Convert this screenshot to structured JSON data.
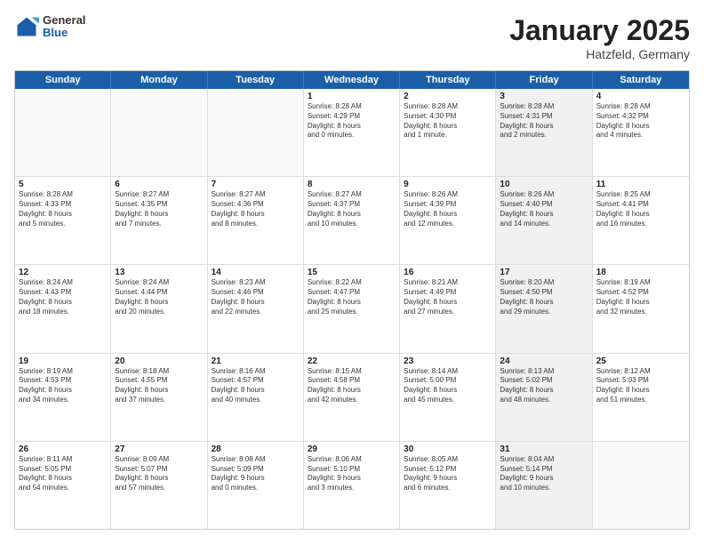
{
  "header": {
    "logo_general": "General",
    "logo_blue": "Blue",
    "title": "January 2025",
    "location": "Hatzfeld, Germany"
  },
  "days_of_week": [
    "Sunday",
    "Monday",
    "Tuesday",
    "Wednesday",
    "Thursday",
    "Friday",
    "Saturday"
  ],
  "rows": [
    [
      {
        "day": "",
        "lines": [],
        "empty": true
      },
      {
        "day": "",
        "lines": [],
        "empty": true
      },
      {
        "day": "",
        "lines": [],
        "empty": true
      },
      {
        "day": "1",
        "lines": [
          "Sunrise: 8:28 AM",
          "Sunset: 4:29 PM",
          "Daylight: 8 hours",
          "and 0 minutes."
        ]
      },
      {
        "day": "2",
        "lines": [
          "Sunrise: 8:28 AM",
          "Sunset: 4:30 PM",
          "Daylight: 8 hours",
          "and 1 minute."
        ]
      },
      {
        "day": "3",
        "lines": [
          "Sunrise: 8:28 AM",
          "Sunset: 4:31 PM",
          "Daylight: 8 hours",
          "and 2 minutes."
        ],
        "shaded": true
      },
      {
        "day": "4",
        "lines": [
          "Sunrise: 8:28 AM",
          "Sunset: 4:32 PM",
          "Daylight: 8 hours",
          "and 4 minutes."
        ]
      }
    ],
    [
      {
        "day": "5",
        "lines": [
          "Sunrise: 8:28 AM",
          "Sunset: 4:33 PM",
          "Daylight: 8 hours",
          "and 5 minutes."
        ]
      },
      {
        "day": "6",
        "lines": [
          "Sunrise: 8:27 AM",
          "Sunset: 4:35 PM",
          "Daylight: 8 hours",
          "and 7 minutes."
        ]
      },
      {
        "day": "7",
        "lines": [
          "Sunrise: 8:27 AM",
          "Sunset: 4:36 PM",
          "Daylight: 8 hours",
          "and 8 minutes."
        ]
      },
      {
        "day": "8",
        "lines": [
          "Sunrise: 8:27 AM",
          "Sunset: 4:37 PM",
          "Daylight: 8 hours",
          "and 10 minutes."
        ]
      },
      {
        "day": "9",
        "lines": [
          "Sunrise: 8:26 AM",
          "Sunset: 4:39 PM",
          "Daylight: 8 hours",
          "and 12 minutes."
        ]
      },
      {
        "day": "10",
        "lines": [
          "Sunrise: 8:26 AM",
          "Sunset: 4:40 PM",
          "Daylight: 8 hours",
          "and 14 minutes."
        ],
        "shaded": true
      },
      {
        "day": "11",
        "lines": [
          "Sunrise: 8:25 AM",
          "Sunset: 4:41 PM",
          "Daylight: 8 hours",
          "and 16 minutes."
        ]
      }
    ],
    [
      {
        "day": "12",
        "lines": [
          "Sunrise: 8:24 AM",
          "Sunset: 4:43 PM",
          "Daylight: 8 hours",
          "and 18 minutes."
        ]
      },
      {
        "day": "13",
        "lines": [
          "Sunrise: 8:24 AM",
          "Sunset: 4:44 PM",
          "Daylight: 8 hours",
          "and 20 minutes."
        ]
      },
      {
        "day": "14",
        "lines": [
          "Sunrise: 8:23 AM",
          "Sunset: 4:46 PM",
          "Daylight: 8 hours",
          "and 22 minutes."
        ]
      },
      {
        "day": "15",
        "lines": [
          "Sunrise: 8:22 AM",
          "Sunset: 4:47 PM",
          "Daylight: 8 hours",
          "and 25 minutes."
        ]
      },
      {
        "day": "16",
        "lines": [
          "Sunrise: 8:21 AM",
          "Sunset: 4:49 PM",
          "Daylight: 8 hours",
          "and 27 minutes."
        ]
      },
      {
        "day": "17",
        "lines": [
          "Sunrise: 8:20 AM",
          "Sunset: 4:50 PM",
          "Daylight: 8 hours",
          "and 29 minutes."
        ],
        "shaded": true
      },
      {
        "day": "18",
        "lines": [
          "Sunrise: 8:19 AM",
          "Sunset: 4:52 PM",
          "Daylight: 8 hours",
          "and 32 minutes."
        ]
      }
    ],
    [
      {
        "day": "19",
        "lines": [
          "Sunrise: 8:19 AM",
          "Sunset: 4:53 PM",
          "Daylight: 8 hours",
          "and 34 minutes."
        ]
      },
      {
        "day": "20",
        "lines": [
          "Sunrise: 8:18 AM",
          "Sunset: 4:55 PM",
          "Daylight: 8 hours",
          "and 37 minutes."
        ]
      },
      {
        "day": "21",
        "lines": [
          "Sunrise: 8:16 AM",
          "Sunset: 4:57 PM",
          "Daylight: 8 hours",
          "and 40 minutes."
        ]
      },
      {
        "day": "22",
        "lines": [
          "Sunrise: 8:15 AM",
          "Sunset: 4:58 PM",
          "Daylight: 8 hours",
          "and 42 minutes."
        ]
      },
      {
        "day": "23",
        "lines": [
          "Sunrise: 8:14 AM",
          "Sunset: 5:00 PM",
          "Daylight: 8 hours",
          "and 45 minutes."
        ]
      },
      {
        "day": "24",
        "lines": [
          "Sunrise: 8:13 AM",
          "Sunset: 5:02 PM",
          "Daylight: 8 hours",
          "and 48 minutes."
        ],
        "shaded": true
      },
      {
        "day": "25",
        "lines": [
          "Sunrise: 8:12 AM",
          "Sunset: 5:03 PM",
          "Daylight: 8 hours",
          "and 51 minutes."
        ]
      }
    ],
    [
      {
        "day": "26",
        "lines": [
          "Sunrise: 8:11 AM",
          "Sunset: 5:05 PM",
          "Daylight: 8 hours",
          "and 54 minutes."
        ]
      },
      {
        "day": "27",
        "lines": [
          "Sunrise: 8:09 AM",
          "Sunset: 5:07 PM",
          "Daylight: 8 hours",
          "and 57 minutes."
        ]
      },
      {
        "day": "28",
        "lines": [
          "Sunrise: 8:08 AM",
          "Sunset: 5:09 PM",
          "Daylight: 9 hours",
          "and 0 minutes."
        ]
      },
      {
        "day": "29",
        "lines": [
          "Sunrise: 8:06 AM",
          "Sunset: 5:10 PM",
          "Daylight: 9 hours",
          "and 3 minutes."
        ]
      },
      {
        "day": "30",
        "lines": [
          "Sunrise: 8:05 AM",
          "Sunset: 5:12 PM",
          "Daylight: 9 hours",
          "and 6 minutes."
        ]
      },
      {
        "day": "31",
        "lines": [
          "Sunrise: 8:04 AM",
          "Sunset: 5:14 PM",
          "Daylight: 9 hours",
          "and 10 minutes."
        ],
        "shaded": true
      },
      {
        "day": "",
        "lines": [],
        "empty": true
      }
    ]
  ]
}
